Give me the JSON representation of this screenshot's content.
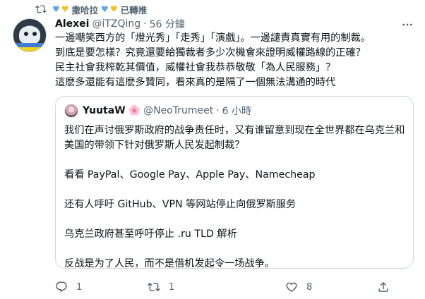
{
  "retweet": {
    "name": "撒哈拉",
    "suffix": "已轉推"
  },
  "tweet": {
    "display_name": "Alexei",
    "handle": "@iTZQing",
    "separator": "·",
    "time": "56 分鐘",
    "text": "一邊嘲笑西方的「燈光秀」「走秀」「演戲」。一邊譴責真實有用的制裁。\n到底是要怎樣？究竟還要給獨裁者多少次機會來證明威權路線的正確？\n民主社會我榨乾其價值，威權社會我恭恭敬敬「為人民服務」？\n這麽多還能有這麽多贊同，看來真的是隔了一個無法溝通的時代"
  },
  "quoted": {
    "display_name": "YuutaW",
    "emoji": "🌸",
    "handle": "@NeoTrumeet",
    "separator": "·",
    "time": "6 小時",
    "text": "我们在声讨俄罗斯政府的战争责任时，又有谁留意到现在全世界都在乌克兰和美国的带领下针对俄罗斯人民发起制裁？\n\n看看 PayPal、Google Pay、Apple Pay、Namecheap\n\n还有人呼吁 GitHub、VPN 等网站停止向俄罗斯服务\n\n乌克兰政府甚至呼吁停止 .ru TLD 解析\n\n反战是为了人民，而不是借机发起令一场战争。"
  },
  "actions": {
    "reply_count": "1",
    "retweet_count": "1",
    "like_count": "8"
  },
  "icons": {
    "retweet_bar": "retweet-icon",
    "more": "more-icon",
    "reply": "reply-icon",
    "retweet": "retweet-icon",
    "like": "heart-icon",
    "share": "share-icon"
  },
  "colors": {
    "text_primary": "#0f1419",
    "text_secondary": "#536471",
    "border": "#cfd9de"
  }
}
